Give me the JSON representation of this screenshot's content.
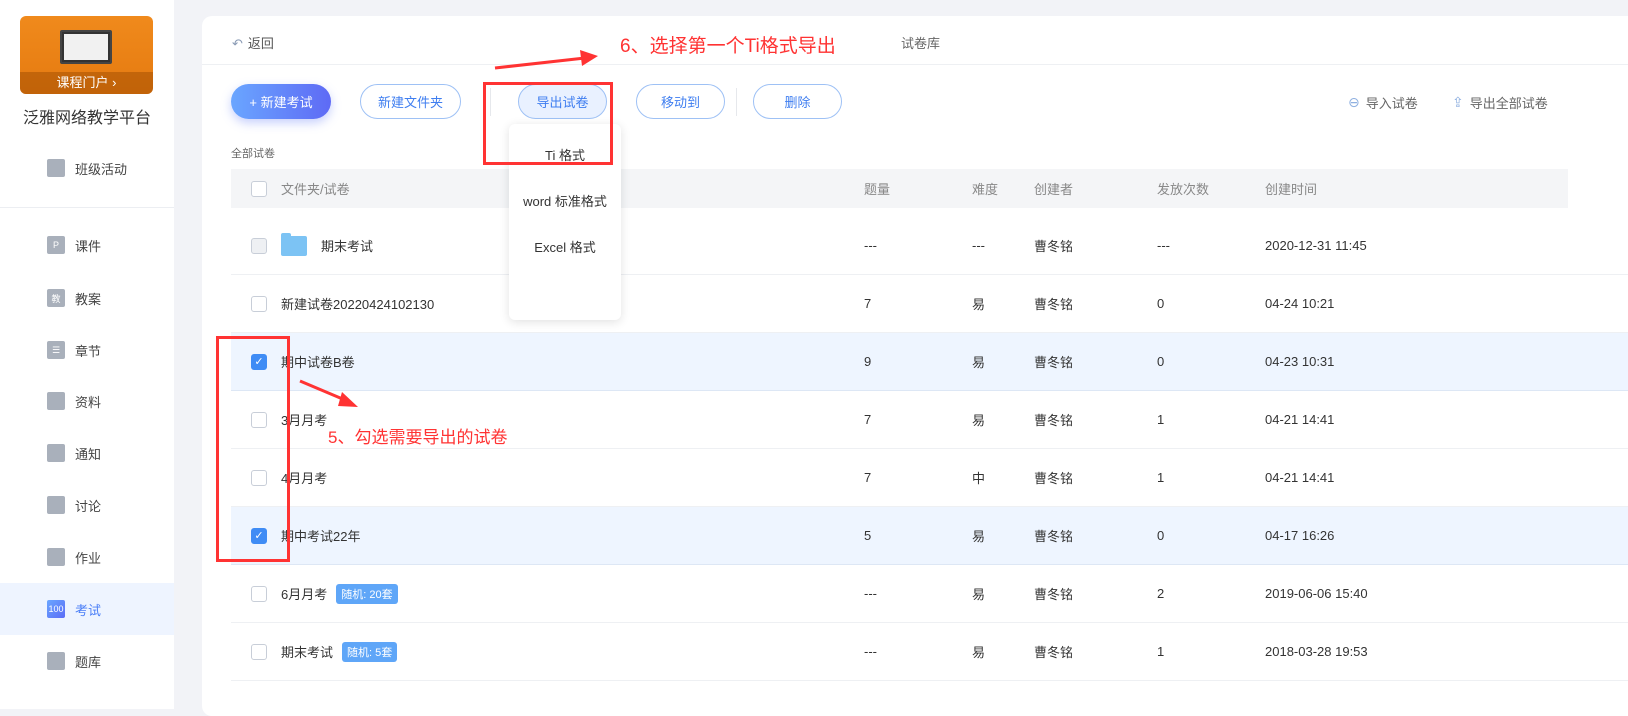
{
  "sidebar": {
    "banner_label": "课程门户 ›",
    "platform": "泛雅网络教学平台",
    "top_item": "班级活动",
    "items": [
      {
        "label": "课件",
        "icon": "P"
      },
      {
        "label": "教案",
        "icon": "教"
      },
      {
        "label": "章节",
        "icon": "☰"
      },
      {
        "label": "资料",
        "icon": ""
      },
      {
        "label": "通知",
        "icon": ""
      },
      {
        "label": "讨论",
        "icon": ""
      },
      {
        "label": "作业",
        "icon": ""
      },
      {
        "label": "考试",
        "icon": "100"
      },
      {
        "label": "题库",
        "icon": ""
      }
    ]
  },
  "header": {
    "back_icon": "↶",
    "back": "返回",
    "crumb": "试卷库"
  },
  "toolbar": {
    "new_exam": "+ 新建考试",
    "new_folder": "新建文件夹",
    "export": "导出试卷",
    "move": "移动到",
    "delete": "删除",
    "import": "导入试卷",
    "import_icon": "⊖",
    "export_all": "导出全部试卷",
    "export_all_icon": "⇪"
  },
  "section": "全部试卷",
  "dropdown": [
    "Ti 格式",
    "word 标准格式",
    "Excel 格式"
  ],
  "table": {
    "headers": [
      "文件夹/试卷",
      "题量",
      "难度",
      "创建者",
      "发放次数",
      "创建时间"
    ],
    "rows": [
      {
        "name": "期末考试",
        "folder": true,
        "count": "---",
        "diff": "---",
        "creator": "曹冬铭",
        "times": "---",
        "time": "2020-12-31 11:45",
        "checked": false
      },
      {
        "name": "新建试卷20220424102130",
        "count": "7",
        "diff": "易",
        "creator": "曹冬铭",
        "times": "0",
        "time": "04-24 10:21",
        "checked": false
      },
      {
        "name": "期中试卷B卷",
        "count": "9",
        "diff": "易",
        "creator": "曹冬铭",
        "times": "0",
        "time": "04-23 10:31",
        "checked": true
      },
      {
        "name": "3月月考",
        "count": "7",
        "diff": "易",
        "creator": "曹冬铭",
        "times": "1",
        "time": "04-21 14:41",
        "checked": false
      },
      {
        "name": "4月月考",
        "count": "7",
        "diff": "中",
        "creator": "曹冬铭",
        "times": "1",
        "time": "04-21 14:41",
        "checked": false
      },
      {
        "name": "期中考试22年",
        "count": "5",
        "diff": "易",
        "creator": "曹冬铭",
        "times": "0",
        "time": "04-17 16:26",
        "checked": true
      },
      {
        "name": "6月月考",
        "badge": "随机: 20套",
        "count": "---",
        "diff": "易",
        "creator": "曹冬铭",
        "times": "2",
        "time": "2019-06-06 15:40",
        "checked": false
      },
      {
        "name": "期末考试",
        "badge": "随机: 5套",
        "count": "---",
        "diff": "易",
        "creator": "曹冬铭",
        "times": "1",
        "time": "2018-03-28 19:53",
        "checked": false
      }
    ]
  },
  "annotations": {
    "step6": "6、选择第一个Ti格式导出",
    "step5": "5、勾选需要导出的试卷"
  }
}
